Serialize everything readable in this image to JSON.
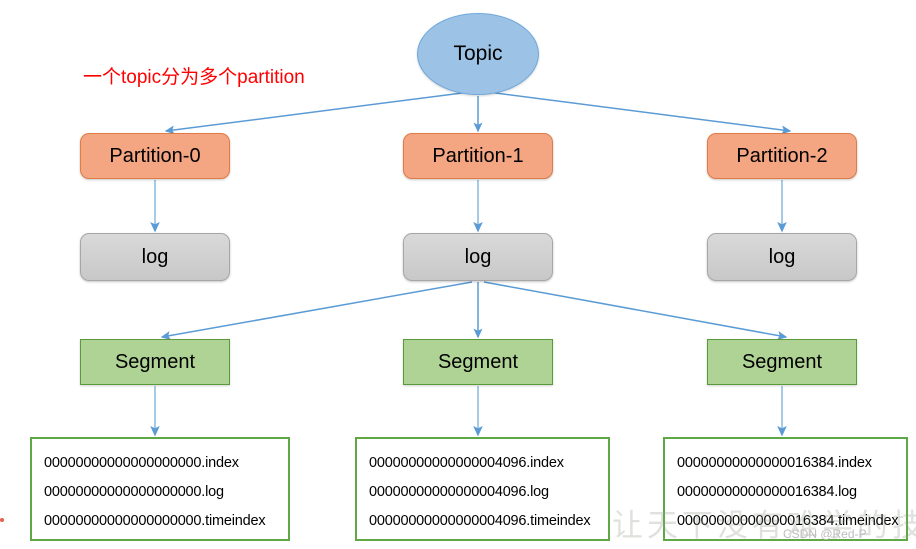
{
  "diagram": {
    "title_node": {
      "label": "Topic"
    },
    "annotation": {
      "text": "一个topic分为多个partition",
      "color": "#FF0000"
    },
    "columns": [
      {
        "partition": "Partition-0",
        "log": "log",
        "segment": "Segment",
        "files": [
          "00000000000000000000.index",
          "00000000000000000000.log",
          "00000000000000000000.timeindex"
        ]
      },
      {
        "partition": "Partition-1",
        "log": "log",
        "segment": "Segment",
        "files": [
          "00000000000000004096.index",
          "00000000000000004096.log",
          "00000000000000004096.timeindex"
        ]
      },
      {
        "partition": "Partition-2",
        "log": "log",
        "segment": "Segment",
        "files": [
          "00000000000000016384.index",
          "00000000000000016384.log",
          "00000000000000016384.timeindex"
        ]
      }
    ],
    "watermarks": {
      "csdn": "CSDN @Red-P",
      "background": "让天下没有难学的技术"
    },
    "colors": {
      "topic_fill": "#9CC3E5",
      "partition_fill": "#F4A582",
      "log_fill": "#D0D0D0",
      "segment_fill": "#AFD295",
      "segment_border": "#5B9A3B",
      "file_box_border": "#5FA845",
      "arrow": "#5B9BD5",
      "annotation": "#FF0000"
    }
  }
}
